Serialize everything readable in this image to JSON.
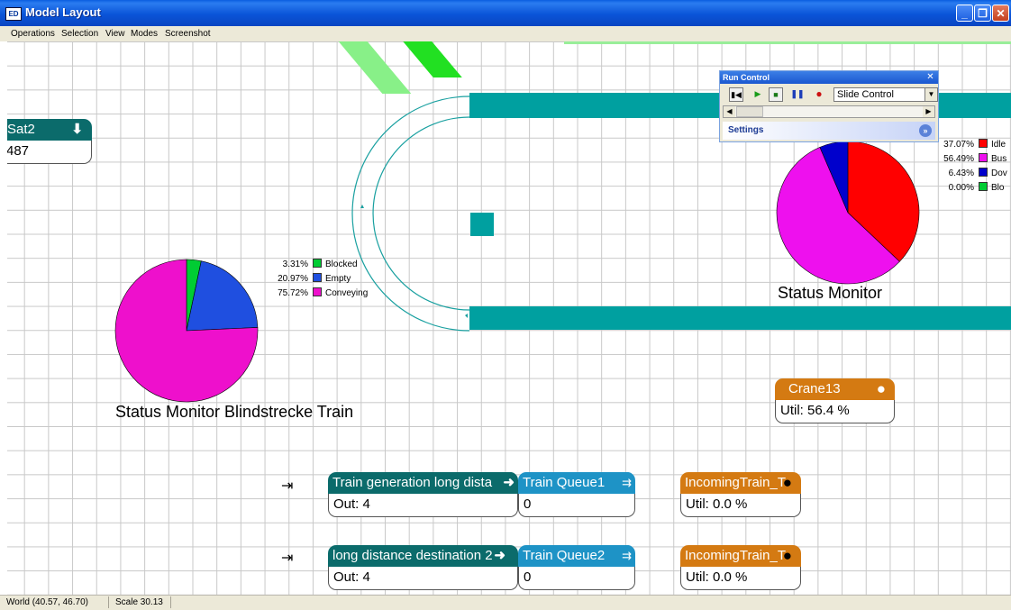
{
  "window": {
    "title": "Model Layout",
    "app_badge": "ED"
  },
  "menu": [
    "Operations",
    "Selection",
    "View",
    "Modes",
    "Screenshot"
  ],
  "colors": {
    "teal_header": "#0b6b6b",
    "orange_header": "#d47a12",
    "blue_header": "#1e93c6",
    "conveyor": "#00a0a0",
    "blocked": "#00cc33",
    "empty": "#1f4fe0",
    "conveying": "#ee10cc",
    "idle": "#ff0000",
    "busy": "#ee10ee",
    "down": "#0000cc"
  },
  "sat_widget": {
    "title": "Sat2",
    "value": "487"
  },
  "status_monitor_train": {
    "caption": "Status Monitor Blindstrecke Train",
    "legend": [
      {
        "pct": "3.31%",
        "label": "Blocked",
        "color": "#00cc33",
        "fraction": 0.0331
      },
      {
        "pct": "20.97%",
        "label": "Empty",
        "color": "#1f4fe0",
        "fraction": 0.2097
      },
      {
        "pct": "75.72%",
        "label": "Conveying",
        "color": "#ee10cc",
        "fraction": 0.7572
      }
    ]
  },
  "status_monitor": {
    "caption": "Status Monitor",
    "legend": [
      {
        "pct": "37.07%",
        "label": "Idle",
        "color": "#ff0000",
        "fraction": 0.3707
      },
      {
        "pct": "56.49%",
        "label": "Bus",
        "color": "#ee10ee",
        "fraction": 0.5649
      },
      {
        "pct": "6.43%",
        "label": "Dov",
        "color": "#0000cc",
        "fraction": 0.0643
      },
      {
        "pct": "0.00%",
        "label": "Blo",
        "color": "#00cc33",
        "fraction": 0.0
      }
    ]
  },
  "crane": {
    "title": "Crane13",
    "value": "Util: 56.4 %"
  },
  "row1": {
    "source": {
      "title": "Train generation long dista",
      "value": "Out: 4"
    },
    "queue": {
      "title": "Train Queue1",
      "value": "0"
    },
    "incoming": {
      "title": "IncomingTrain_T",
      "value": "Util: 0.0 %"
    }
  },
  "row2": {
    "source": {
      "title": "long distance destination 2",
      "value": "Out: 4"
    },
    "queue": {
      "title": "Train Queue2",
      "value": "0"
    },
    "incoming": {
      "title": "IncomingTrain_T",
      "value": "Util: 0.0 %"
    }
  },
  "run_control": {
    "title": "Run Control",
    "speed_option": "Slide Control",
    "settings_label": "Settings"
  },
  "statusbar": {
    "world": "World (40.57, 46.70)",
    "scale": "Scale 30.13"
  }
}
